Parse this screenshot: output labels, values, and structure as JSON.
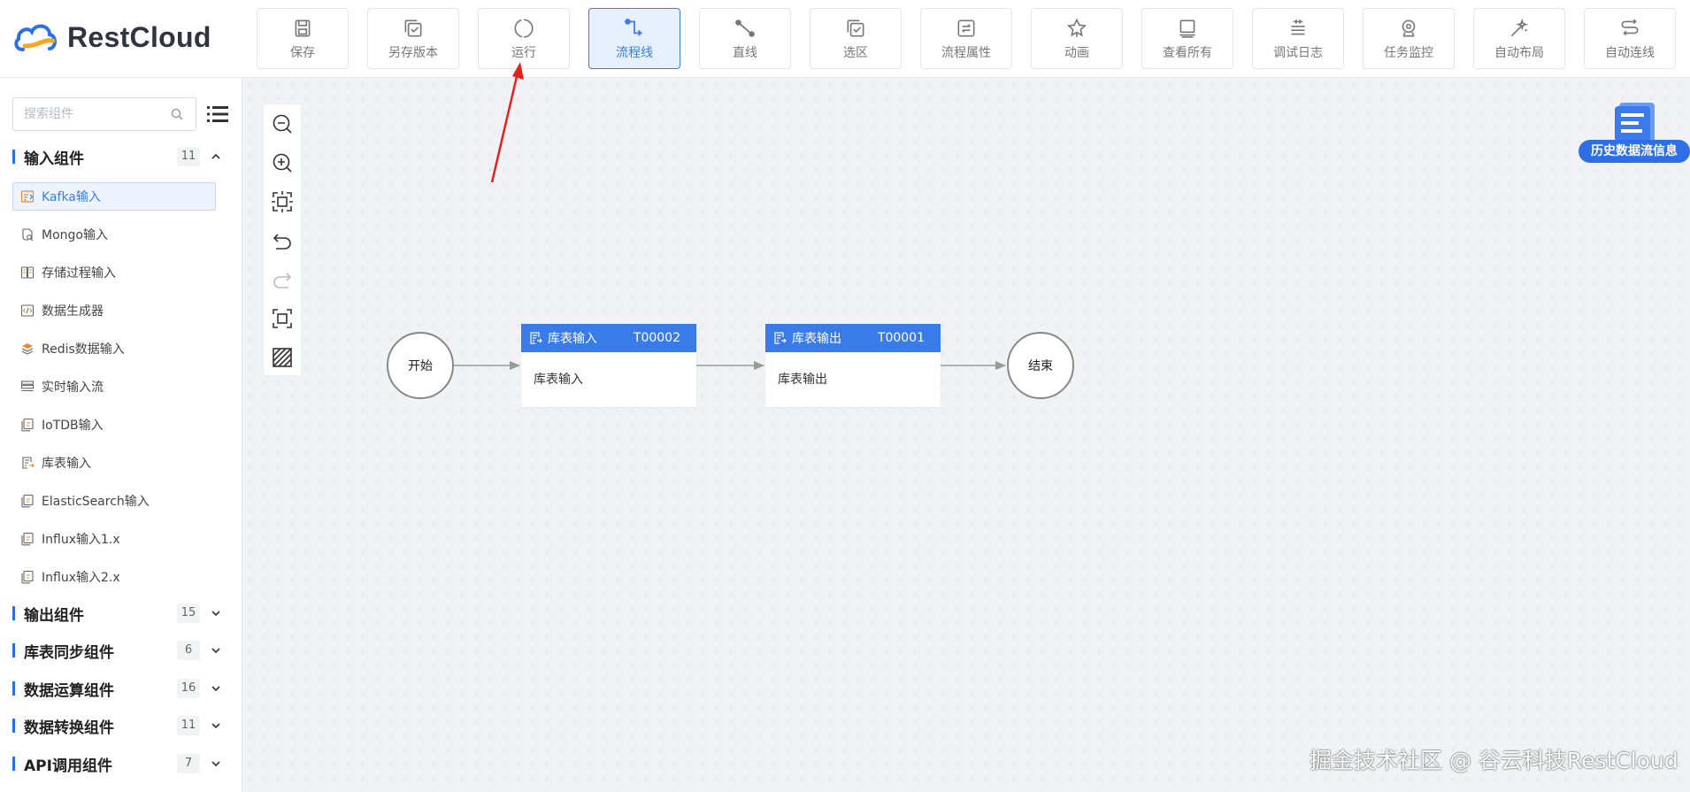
{
  "app": {
    "brand": "RestCloud",
    "brand_color": "#2f6fe6",
    "accent": "#3a7bea"
  },
  "toolbar": {
    "buttons": [
      {
        "label": "保存",
        "icon": "save-icon"
      },
      {
        "label": "另存版本",
        "icon": "copy-version-icon"
      },
      {
        "label": "运行",
        "icon": "run-icon"
      },
      {
        "label": "流程线",
        "icon": "flow-line-icon",
        "active": true
      },
      {
        "label": "直线",
        "icon": "straight-line-icon"
      },
      {
        "label": "选区",
        "icon": "selection-icon"
      },
      {
        "label": "流程属性",
        "icon": "flow-properties-icon"
      },
      {
        "label": "动画",
        "icon": "animation-icon"
      },
      {
        "label": "查看所有",
        "icon": "view-all-icon"
      },
      {
        "label": "调试日志",
        "icon": "debug-log-icon"
      },
      {
        "label": "任务监控",
        "icon": "task-monitor-icon"
      },
      {
        "label": "自动布局",
        "icon": "auto-layout-icon"
      },
      {
        "label": "自动连线",
        "icon": "auto-connect-icon"
      }
    ]
  },
  "sidebar": {
    "search_placeholder": "搜索组件",
    "groups": [
      {
        "title": "输入组件",
        "count": "11",
        "expanded": true,
        "items": [
          {
            "label": "Kafka输入",
            "selected": true,
            "icon": "kafka-icon"
          },
          {
            "label": "Mongo输入",
            "icon": "mongo-icon"
          },
          {
            "label": "存储过程输入",
            "icon": "procedure-icon"
          },
          {
            "label": "数据生成器",
            "icon": "generator-icon"
          },
          {
            "label": "Redis数据输入",
            "icon": "redis-icon"
          },
          {
            "label": "实时输入流",
            "icon": "stream-icon"
          },
          {
            "label": "IoTDB输入",
            "icon": "iotdb-icon"
          },
          {
            "label": "库表输入",
            "icon": "table-input-icon"
          },
          {
            "label": "ElasticSearch输入",
            "icon": "elasticsearch-icon"
          },
          {
            "label": "Influx输入1.x",
            "icon": "influx-icon"
          },
          {
            "label": "Influx输入2.x",
            "icon": "influx-icon"
          }
        ]
      },
      {
        "title": "输出组件",
        "count": "15",
        "expanded": false
      },
      {
        "title": "库表同步组件",
        "count": "6",
        "expanded": false
      },
      {
        "title": "数据运算组件",
        "count": "16",
        "expanded": false
      },
      {
        "title": "数据转换组件",
        "count": "11",
        "expanded": false
      },
      {
        "title": "API调用组件",
        "count": "7",
        "expanded": false
      }
    ]
  },
  "canvas": {
    "history_label": "历史数据流信息",
    "start": "开始",
    "end": "结束",
    "nodes": [
      {
        "title": "库表输入",
        "id": "T00002",
        "body": "库表输入"
      },
      {
        "title": "库表输出",
        "id": "T00001",
        "body": "库表输出"
      }
    ],
    "watermark": "掘金技术社区 @ 谷云科技RestCloud"
  }
}
